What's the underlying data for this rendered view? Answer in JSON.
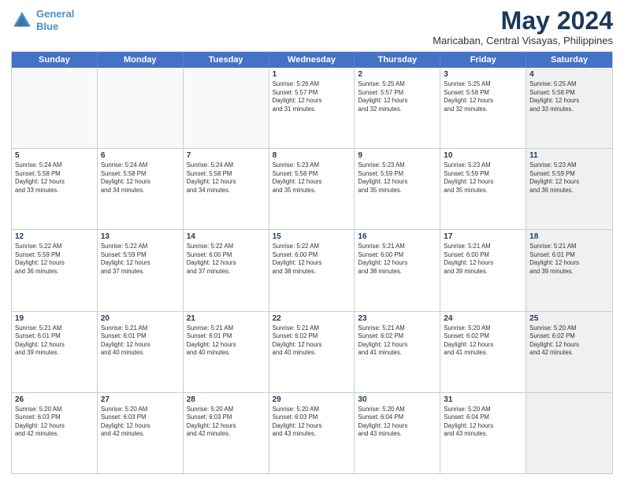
{
  "logo": {
    "line1": "General",
    "line2": "Blue"
  },
  "title": "May 2024",
  "location": "Maricaban, Central Visayas, Philippines",
  "days_of_week": [
    "Sunday",
    "Monday",
    "Tuesday",
    "Wednesday",
    "Thursday",
    "Friday",
    "Saturday"
  ],
  "rows": [
    [
      {
        "day": "",
        "info": "",
        "empty": true
      },
      {
        "day": "",
        "info": "",
        "empty": true
      },
      {
        "day": "",
        "info": "",
        "empty": true
      },
      {
        "day": "1",
        "info": "Sunrise: 5:26 AM\nSunset: 5:57 PM\nDaylight: 12 hours\nand 31 minutes."
      },
      {
        "day": "2",
        "info": "Sunrise: 5:25 AM\nSunset: 5:57 PM\nDaylight: 12 hours\nand 32 minutes."
      },
      {
        "day": "3",
        "info": "Sunrise: 5:25 AM\nSunset: 5:58 PM\nDaylight: 12 hours\nand 32 minutes."
      },
      {
        "day": "4",
        "info": "Sunrise: 5:25 AM\nSunset: 5:58 PM\nDaylight: 12 hours\nand 33 minutes.",
        "shaded": true
      }
    ],
    [
      {
        "day": "5",
        "info": "Sunrise: 5:24 AM\nSunset: 5:58 PM\nDaylight: 12 hours\nand 33 minutes."
      },
      {
        "day": "6",
        "info": "Sunrise: 5:24 AM\nSunset: 5:58 PM\nDaylight: 12 hours\nand 34 minutes."
      },
      {
        "day": "7",
        "info": "Sunrise: 5:24 AM\nSunset: 5:58 PM\nDaylight: 12 hours\nand 34 minutes."
      },
      {
        "day": "8",
        "info": "Sunrise: 5:23 AM\nSunset: 5:58 PM\nDaylight: 12 hours\nand 35 minutes."
      },
      {
        "day": "9",
        "info": "Sunrise: 5:23 AM\nSunset: 5:59 PM\nDaylight: 12 hours\nand 35 minutes."
      },
      {
        "day": "10",
        "info": "Sunrise: 5:23 AM\nSunset: 5:59 PM\nDaylight: 12 hours\nand 35 minutes."
      },
      {
        "day": "11",
        "info": "Sunrise: 5:23 AM\nSunset: 5:59 PM\nDaylight: 12 hours\nand 36 minutes.",
        "shaded": true
      }
    ],
    [
      {
        "day": "12",
        "info": "Sunrise: 5:22 AM\nSunset: 5:59 PM\nDaylight: 12 hours\nand 36 minutes."
      },
      {
        "day": "13",
        "info": "Sunrise: 5:22 AM\nSunset: 5:59 PM\nDaylight: 12 hours\nand 37 minutes."
      },
      {
        "day": "14",
        "info": "Sunrise: 5:22 AM\nSunset: 6:00 PM\nDaylight: 12 hours\nand 37 minutes."
      },
      {
        "day": "15",
        "info": "Sunrise: 5:22 AM\nSunset: 6:00 PM\nDaylight: 12 hours\nand 38 minutes."
      },
      {
        "day": "16",
        "info": "Sunrise: 5:21 AM\nSunset: 6:00 PM\nDaylight: 12 hours\nand 38 minutes."
      },
      {
        "day": "17",
        "info": "Sunrise: 5:21 AM\nSunset: 6:00 PM\nDaylight: 12 hours\nand 39 minutes."
      },
      {
        "day": "18",
        "info": "Sunrise: 5:21 AM\nSunset: 6:01 PM\nDaylight: 12 hours\nand 39 minutes.",
        "shaded": true
      }
    ],
    [
      {
        "day": "19",
        "info": "Sunrise: 5:21 AM\nSunset: 6:01 PM\nDaylight: 12 hours\nand 39 minutes."
      },
      {
        "day": "20",
        "info": "Sunrise: 5:21 AM\nSunset: 6:01 PM\nDaylight: 12 hours\nand 40 minutes."
      },
      {
        "day": "21",
        "info": "Sunrise: 5:21 AM\nSunset: 6:01 PM\nDaylight: 12 hours\nand 40 minutes."
      },
      {
        "day": "22",
        "info": "Sunrise: 5:21 AM\nSunset: 6:02 PM\nDaylight: 12 hours\nand 40 minutes."
      },
      {
        "day": "23",
        "info": "Sunrise: 5:21 AM\nSunset: 6:02 PM\nDaylight: 12 hours\nand 41 minutes."
      },
      {
        "day": "24",
        "info": "Sunrise: 5:20 AM\nSunset: 6:02 PM\nDaylight: 12 hours\nand 41 minutes."
      },
      {
        "day": "25",
        "info": "Sunrise: 5:20 AM\nSunset: 6:02 PM\nDaylight: 12 hours\nand 42 minutes.",
        "shaded": true
      }
    ],
    [
      {
        "day": "26",
        "info": "Sunrise: 5:20 AM\nSunset: 6:03 PM\nDaylight: 12 hours\nand 42 minutes."
      },
      {
        "day": "27",
        "info": "Sunrise: 5:20 AM\nSunset: 6:03 PM\nDaylight: 12 hours\nand 42 minutes."
      },
      {
        "day": "28",
        "info": "Sunrise: 5:20 AM\nSunset: 6:03 PM\nDaylight: 12 hours\nand 42 minutes."
      },
      {
        "day": "29",
        "info": "Sunrise: 5:20 AM\nSunset: 6:03 PM\nDaylight: 12 hours\nand 43 minutes."
      },
      {
        "day": "30",
        "info": "Sunrise: 5:20 AM\nSunset: 6:04 PM\nDaylight: 12 hours\nand 43 minutes."
      },
      {
        "day": "31",
        "info": "Sunrise: 5:20 AM\nSunset: 6:04 PM\nDaylight: 12 hours\nand 43 minutes."
      },
      {
        "day": "",
        "info": "",
        "empty": true,
        "shaded": true
      }
    ]
  ]
}
